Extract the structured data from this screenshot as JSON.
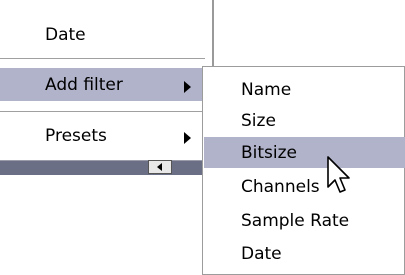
{
  "context_menu": {
    "items": [
      {
        "label": "Date",
        "has_submenu": false,
        "highlighted": false
      },
      {
        "label": "Add filter",
        "has_submenu": true,
        "highlighted": true
      },
      {
        "label": "Presets",
        "has_submenu": true,
        "highlighted": false
      }
    ]
  },
  "submenu": {
    "items": [
      {
        "label": "Name",
        "highlighted": false
      },
      {
        "label": "Size",
        "highlighted": false
      },
      {
        "label": "Bitsize",
        "highlighted": true
      },
      {
        "label": "Channels",
        "highlighted": false
      },
      {
        "label": "Sample Rate",
        "highlighted": false
      },
      {
        "label": "Date",
        "highlighted": false
      }
    ]
  },
  "colors": {
    "highlight": "#b1b3ca",
    "menu_bg": "#ffffff",
    "border": "#9c9c9c"
  }
}
